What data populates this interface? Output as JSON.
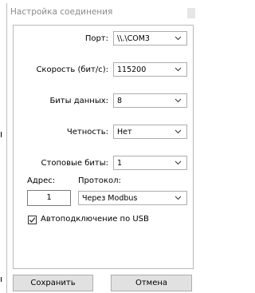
{
  "window": {
    "title": "Настройка соединения"
  },
  "form": {
    "port": {
      "label": "Порт:",
      "value": "\\\\.\\COM3"
    },
    "speed": {
      "label": "Скорость (бит/с):",
      "value": "115200"
    },
    "databits": {
      "label": "Биты данных:",
      "value": "8"
    },
    "parity": {
      "label": "Четность:",
      "value": "Нет"
    },
    "stopbits": {
      "label": "Стоповые биты:",
      "value": "1"
    },
    "address": {
      "label": "Адрес:",
      "value": "1"
    },
    "protocol": {
      "label": "Протокол:",
      "value": "Через Modbus"
    },
    "autoconnect": {
      "label": "Автоподключение по USB",
      "checked": true
    }
  },
  "buttons": {
    "save": "Сохранить",
    "cancel": "Отмена"
  }
}
